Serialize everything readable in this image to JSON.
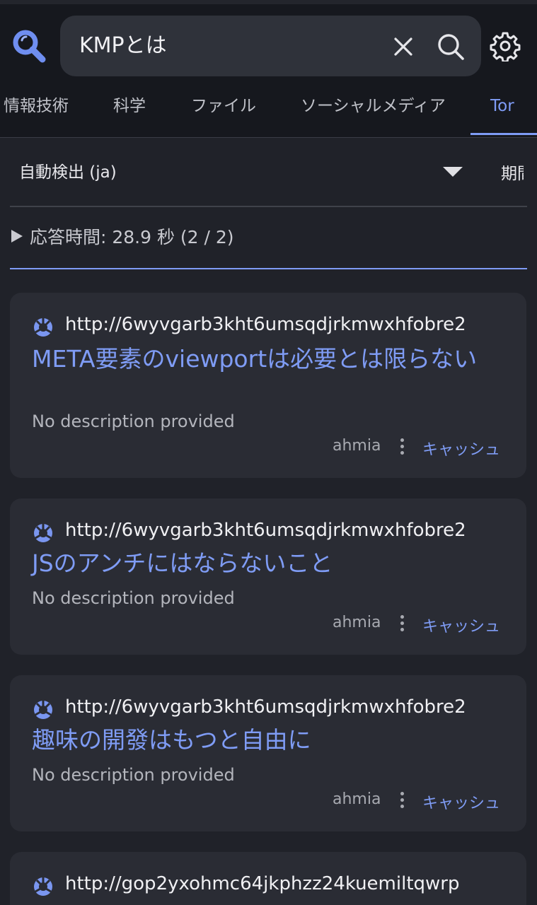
{
  "search": {
    "query": "KMPとは"
  },
  "tabs": [
    {
      "label": "情報技術"
    },
    {
      "label": "科学"
    },
    {
      "label": "ファイル"
    },
    {
      "label": "ソーシャルメディア"
    },
    {
      "label": "Tor",
      "active": true
    }
  ],
  "filters": {
    "language": "自動検出 (ja)",
    "period": "期間"
  },
  "response": {
    "text": "応答時間: 28.9 秒 (2 / 2)"
  },
  "results": [
    {
      "url": "http://6wyvgarb3kht6umsqdjrkmwxhfobre2",
      "title": "META要素のviewportは必要とは限らない",
      "description": "No description provided",
      "engine": "ahmia",
      "cache": "キャッシュ"
    },
    {
      "url": "http://6wyvgarb3kht6umsqdjrkmwxhfobre2",
      "title": "JSのアンチにはならないこと",
      "description": "No description provided",
      "engine": "ahmia",
      "cache": "キャッシュ"
    },
    {
      "url": "http://6wyvgarb3kht6umsqdjrkmwxhfobre2",
      "title": "趣味の開發はもつと自由に",
      "description": "No description provided",
      "engine": "ahmia",
      "cache": "キャッシュ"
    },
    {
      "url": "http://gop2yxohmc64jkphzz24kuemiltqwrp"
    }
  ],
  "colors": {
    "accent": "#7f9cf5",
    "background": "#202229",
    "card": "#2a2c34",
    "header": "#16181e"
  },
  "icons": {
    "logo": "magnifier-logo-icon",
    "clear": "close-icon",
    "search": "search-icon",
    "settings": "gear-icon",
    "result": "tor-onion-icon"
  }
}
